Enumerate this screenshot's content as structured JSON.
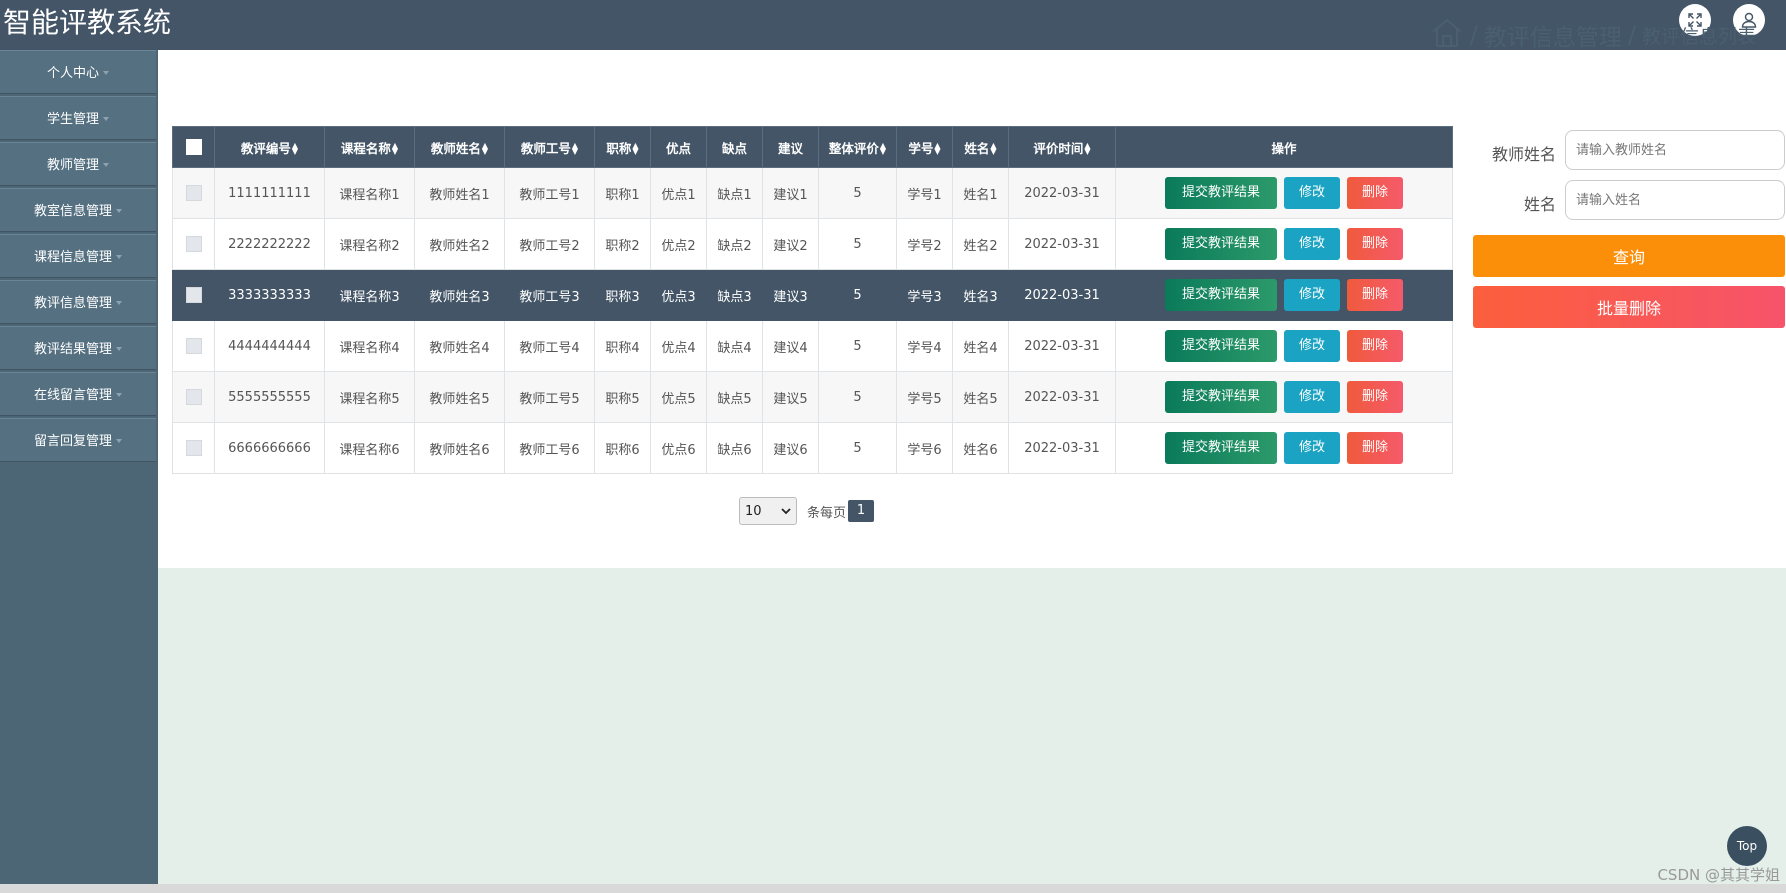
{
  "app": {
    "title": "智能评教系统"
  },
  "header": {
    "fullscreen_icon": "fullscreen-icon",
    "user_icon": "user-icon"
  },
  "sidebar": {
    "items": [
      {
        "label": "个人中心"
      },
      {
        "label": "学生管理"
      },
      {
        "label": "教师管理"
      },
      {
        "label": "教室信息管理"
      },
      {
        "label": "课程信息管理"
      },
      {
        "label": "教评信息管理"
      },
      {
        "label": "教评结果管理"
      },
      {
        "label": "在线留言管理"
      },
      {
        "label": "留言回复管理"
      }
    ]
  },
  "breadcrumb": {
    "home_icon": "home-icon",
    "sep": "/",
    "level1": "教评信息管理",
    "level2": "教评信息列表"
  },
  "table": {
    "headers": [
      "教评编号",
      "课程名称",
      "教师姓名",
      "教师工号",
      "职称",
      "优点",
      "缺点",
      "建议",
      "整体评价",
      "学号",
      "姓名",
      "评价时间",
      "操作"
    ],
    "rows": [
      [
        "1111111111",
        "课程名称1",
        "教师姓名1",
        "教师工号1",
        "职称1",
        "优点1",
        "缺点1",
        "建议1",
        "5",
        "学号1",
        "姓名1",
        "2022-03-31"
      ],
      [
        "2222222222",
        "课程名称2",
        "教师姓名2",
        "教师工号2",
        "职称2",
        "优点2",
        "缺点2",
        "建议2",
        "5",
        "学号2",
        "姓名2",
        "2022-03-31"
      ],
      [
        "3333333333",
        "课程名称3",
        "教师姓名3",
        "教师工号3",
        "职称3",
        "优点3",
        "缺点3",
        "建议3",
        "5",
        "学号3",
        "姓名3",
        "2022-03-31"
      ],
      [
        "4444444444",
        "课程名称4",
        "教师姓名4",
        "教师工号4",
        "职称4",
        "优点4",
        "缺点4",
        "建议4",
        "5",
        "学号4",
        "姓名4",
        "2022-03-31"
      ],
      [
        "5555555555",
        "课程名称5",
        "教师姓名5",
        "教师工号5",
        "职称5",
        "优点5",
        "缺点5",
        "建议5",
        "5",
        "学号5",
        "姓名5",
        "2022-03-31"
      ],
      [
        "6666666666",
        "课程名称6",
        "教师姓名6",
        "教师工号6",
        "职称6",
        "优点6",
        "缺点6",
        "建议6",
        "5",
        "学号6",
        "姓名6",
        "2022-03-31"
      ]
    ],
    "actions": {
      "submit": "提交教评结果",
      "edit": "修改",
      "delete": "删除"
    },
    "highlighted_row": 3
  },
  "pagination": {
    "page_size": "10",
    "per_page_label": "条每页",
    "current_page": "1"
  },
  "search": {
    "teacher_name_label": "教师姓名",
    "teacher_name_placeholder": "请输入教师姓名",
    "name_label": "姓名",
    "name_placeholder": "请输入姓名",
    "query_label": "查询",
    "batch_delete_label": "批量删除"
  },
  "footer": {
    "top_label": "Top",
    "watermark": "CSDN @其其学姐"
  },
  "colors": {
    "header_bg": "#435566",
    "query": "#fb8f0a",
    "delete": "#f55a4a",
    "submit": "#0a7a5a",
    "edit": "#1aa3c2"
  }
}
